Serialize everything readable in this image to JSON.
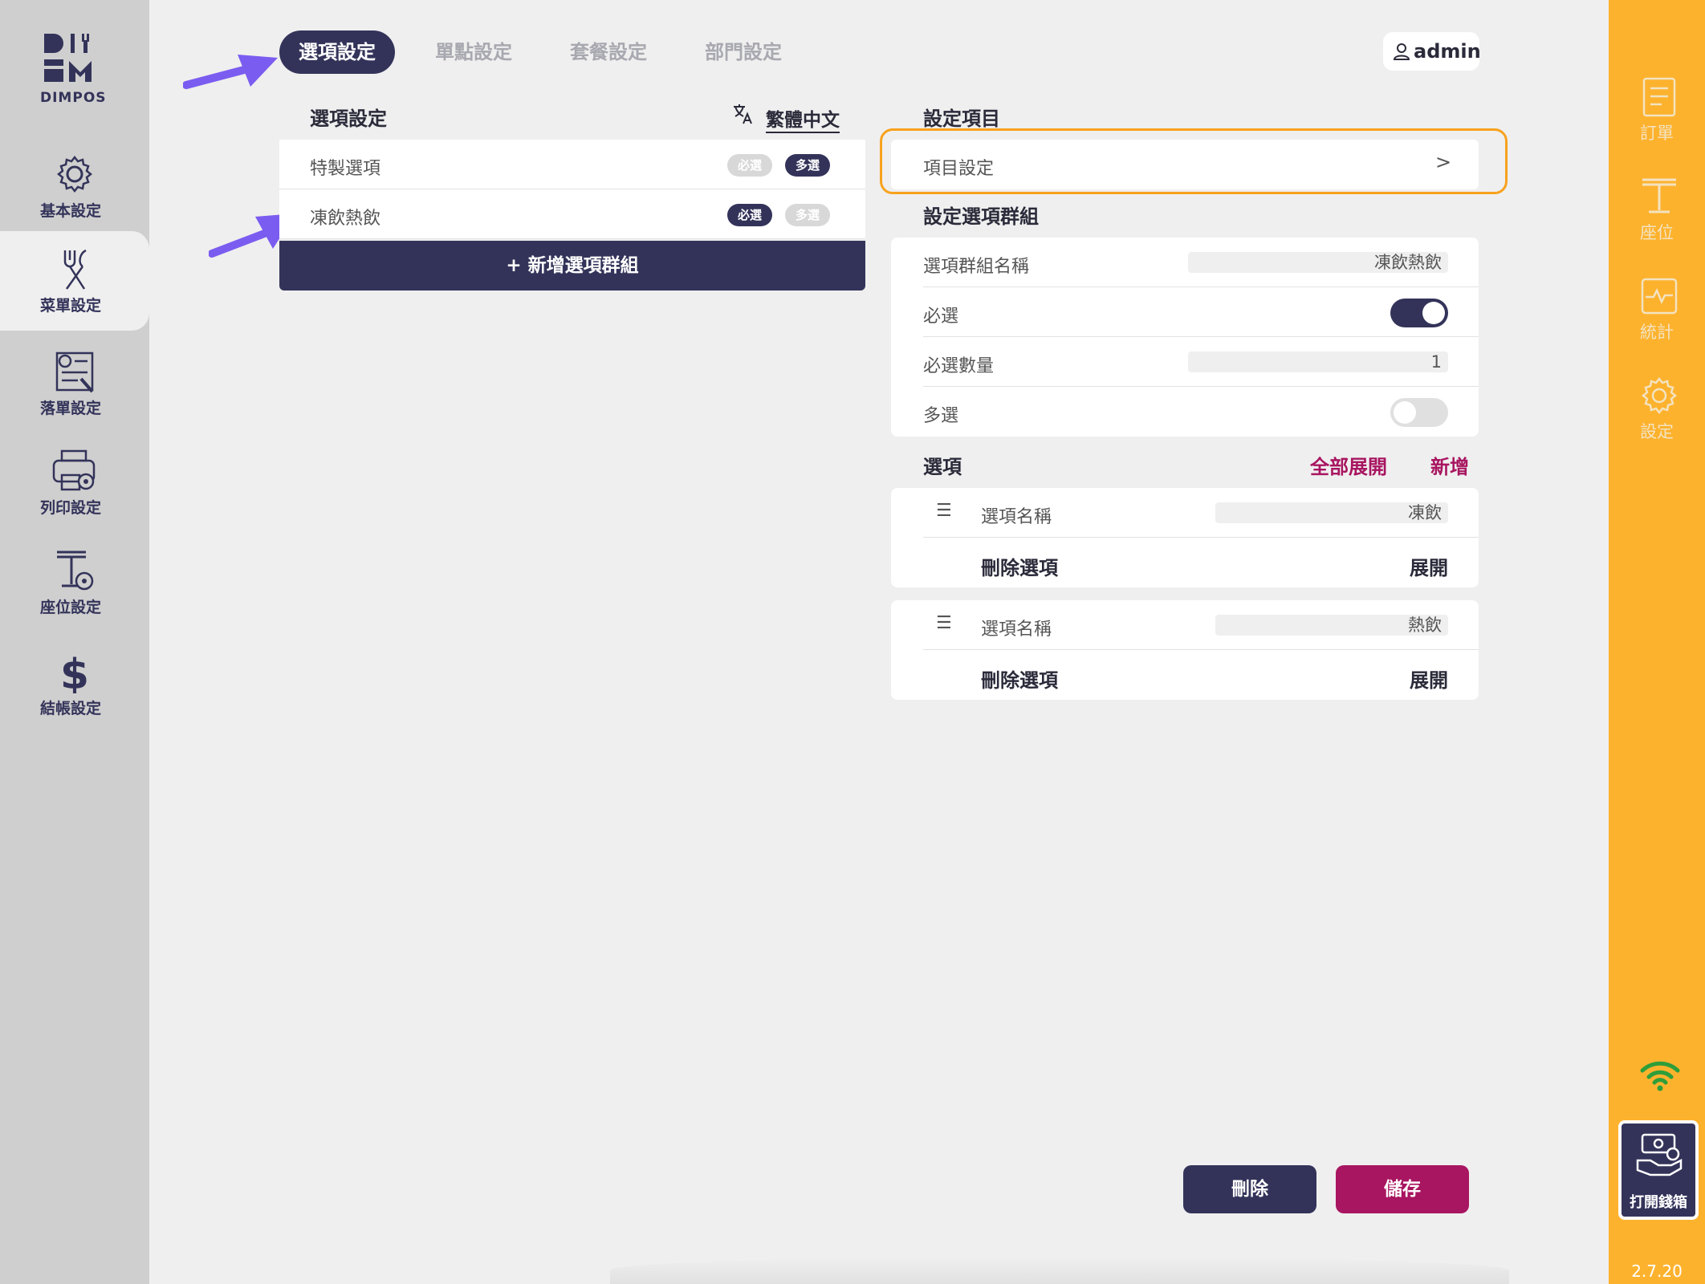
{
  "app": {
    "logo_text": "DIMPOS",
    "version": "2.7.20"
  },
  "colors": {
    "primary": "#33335a",
    "accent": "#a81560",
    "sidebar_right": "#fdb22e",
    "highlight": "#f7a21e",
    "annotation_arrow": "#7b5cf0"
  },
  "left_nav": [
    {
      "label": "基本設定",
      "icon": "gear-icon"
    },
    {
      "label": "菜單設定",
      "icon": "utensils-icon",
      "active": true
    },
    {
      "label": "落單設定",
      "icon": "order-settings-icon"
    },
    {
      "label": "列印設定",
      "icon": "printer-settings-icon"
    },
    {
      "label": "座位設定",
      "icon": "table-settings-icon"
    },
    {
      "label": "結帳設定",
      "icon": "dollar-icon"
    }
  ],
  "right_nav": [
    {
      "label": "訂單",
      "icon": "order-list-icon"
    },
    {
      "label": "座位",
      "icon": "table-icon"
    },
    {
      "label": "統計",
      "icon": "stats-icon"
    },
    {
      "label": "設定",
      "icon": "gear-icon"
    }
  ],
  "cashbox": {
    "label": "打開錢箱",
    "icon": "cash-drawer-icon"
  },
  "tabs": [
    {
      "label": "選項設定",
      "active": true
    },
    {
      "label": "單點設定"
    },
    {
      "label": "套餐設定"
    },
    {
      "label": "部門設定"
    }
  ],
  "user": {
    "name": "admin"
  },
  "left_panel": {
    "title": "選項設定",
    "language": "繁體中文",
    "groups": [
      {
        "name": "特製選項",
        "required_label": "必選",
        "multi_label": "多選",
        "required": false,
        "multi": true
      },
      {
        "name": "凍飲熱飲",
        "required_label": "必選",
        "multi_label": "多選",
        "required": true,
        "multi": false
      }
    ],
    "add_group_label": "+ 新增選項群組"
  },
  "right_panel": {
    "settings_title": "設定項目",
    "item_settings_label": "項目設定",
    "item_settings_chevron": ">",
    "group_title": "設定選項群組",
    "group_fields": {
      "name_label": "選項群組名稱",
      "name_value": "凍飲熱飲",
      "required_label": "必選",
      "required_on": true,
      "required_count_label": "必選數量",
      "required_count_value": "1",
      "multi_label": "多選",
      "multi_on": false
    },
    "options_title": "選項",
    "expand_all_label": "全部展開",
    "add_label": "新增",
    "options": [
      {
        "name_label": "選項名稱",
        "name_value": "凍飲",
        "delete_label": "刪除選項",
        "expand_label": "展開",
        "handle": "☰"
      },
      {
        "name_label": "選項名稱",
        "name_value": "熱飲",
        "delete_label": "刪除選項",
        "expand_label": "展開",
        "handle": "☰"
      }
    ]
  },
  "buttons": {
    "delete_label": "刪除",
    "save_label": "儲存"
  }
}
